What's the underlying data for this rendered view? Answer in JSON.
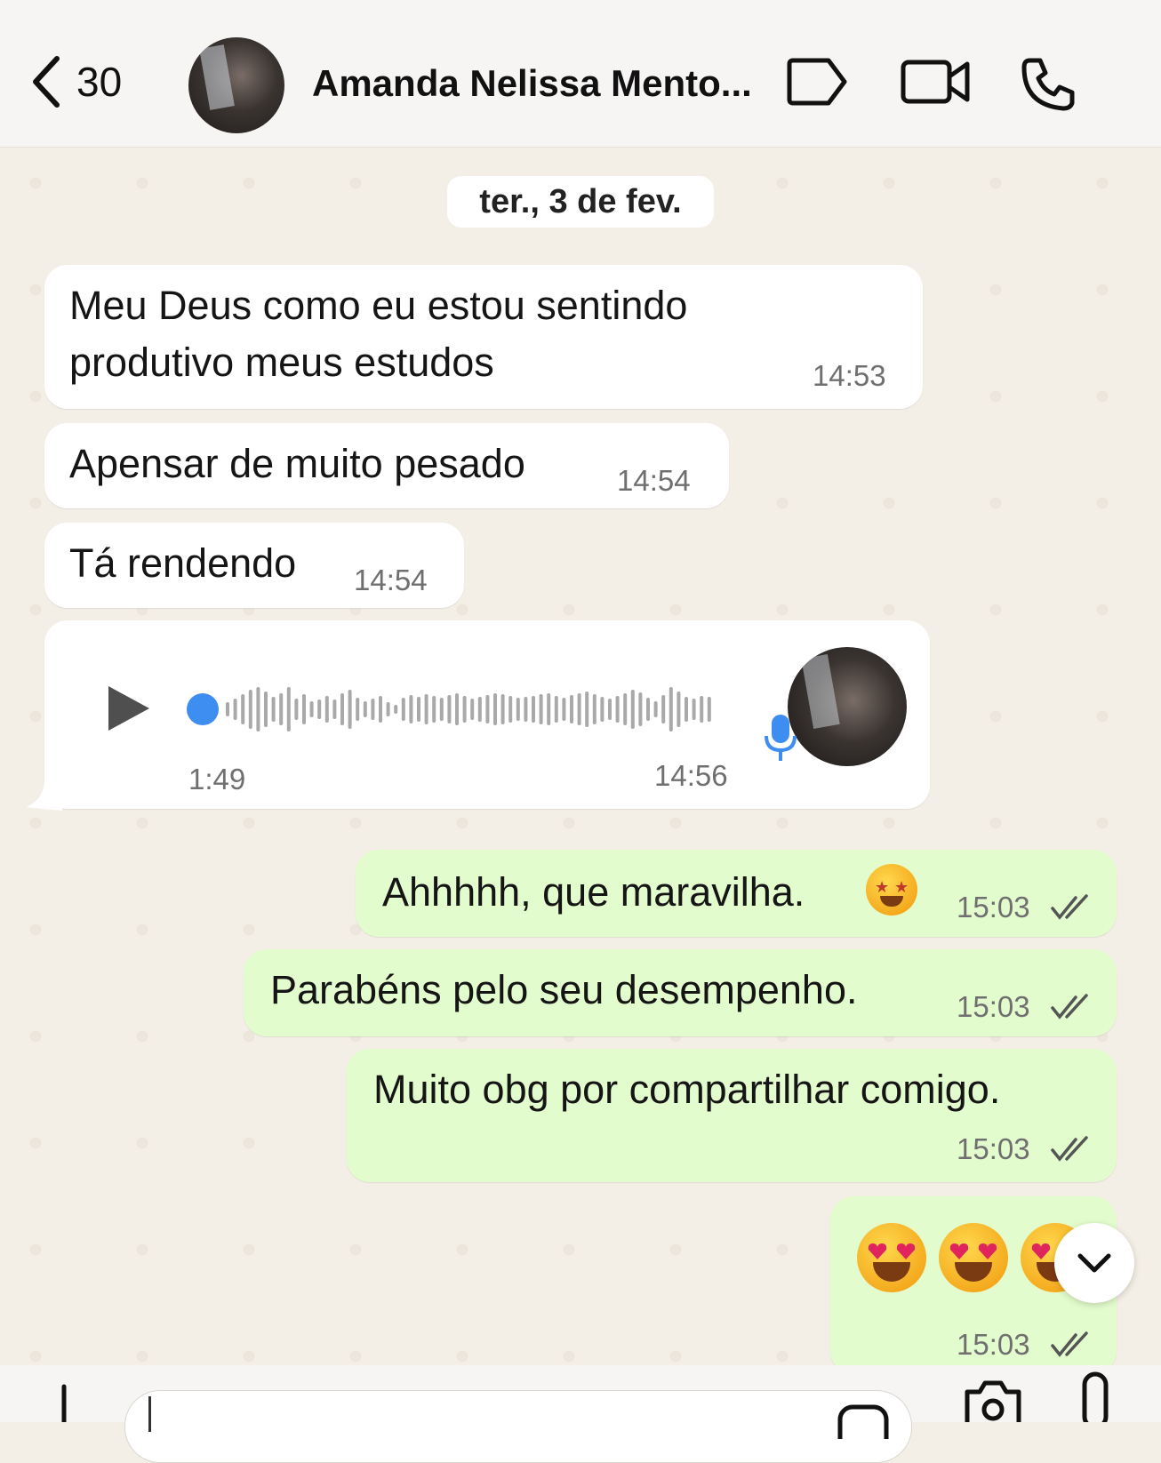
{
  "header": {
    "back_count": "30",
    "contact_name": "Amanda Nelissa Mento...",
    "icons": [
      "back-chevron-icon",
      "label-tag-icon",
      "video-call-icon",
      "phone-call-icon"
    ]
  },
  "chat": {
    "date_chip": "ter., 3 de fev.",
    "incoming": [
      {
        "text_line1": "Meu Deus como eu estou sentindo",
        "text_line2": "produtivo meus estudos",
        "time": "14:53"
      },
      {
        "text": "Apensar de muito pesado",
        "time": "14:54"
      },
      {
        "text": "Tá rendendo",
        "time": "14:54"
      }
    ],
    "voice_note": {
      "duration": "1:49",
      "time": "14:56",
      "played_fraction": 0.0
    },
    "outgoing": [
      {
        "text": "Ahhhhh, que maravilha.",
        "emoji": "star-struck-emoji",
        "time": "15:03",
        "status": "read"
      },
      {
        "text": "Parabéns pelo seu desempenho.",
        "time": "15:03",
        "status": "read"
      },
      {
        "text": "Muito obg por compartilhar comigo.",
        "time": "15:03",
        "status": "read"
      },
      {
        "emojis": [
          "heart-eyes-emoji",
          "heart-eyes-emoji",
          "heart-eyes-emoji"
        ],
        "time": "15:03",
        "status": "read"
      }
    ]
  },
  "colors": {
    "incoming_bubble": "#ffffff",
    "outgoing_bubble": "#e3fccd",
    "accent_blue": "#3d8ef0",
    "chat_background": "#f4efe6"
  }
}
